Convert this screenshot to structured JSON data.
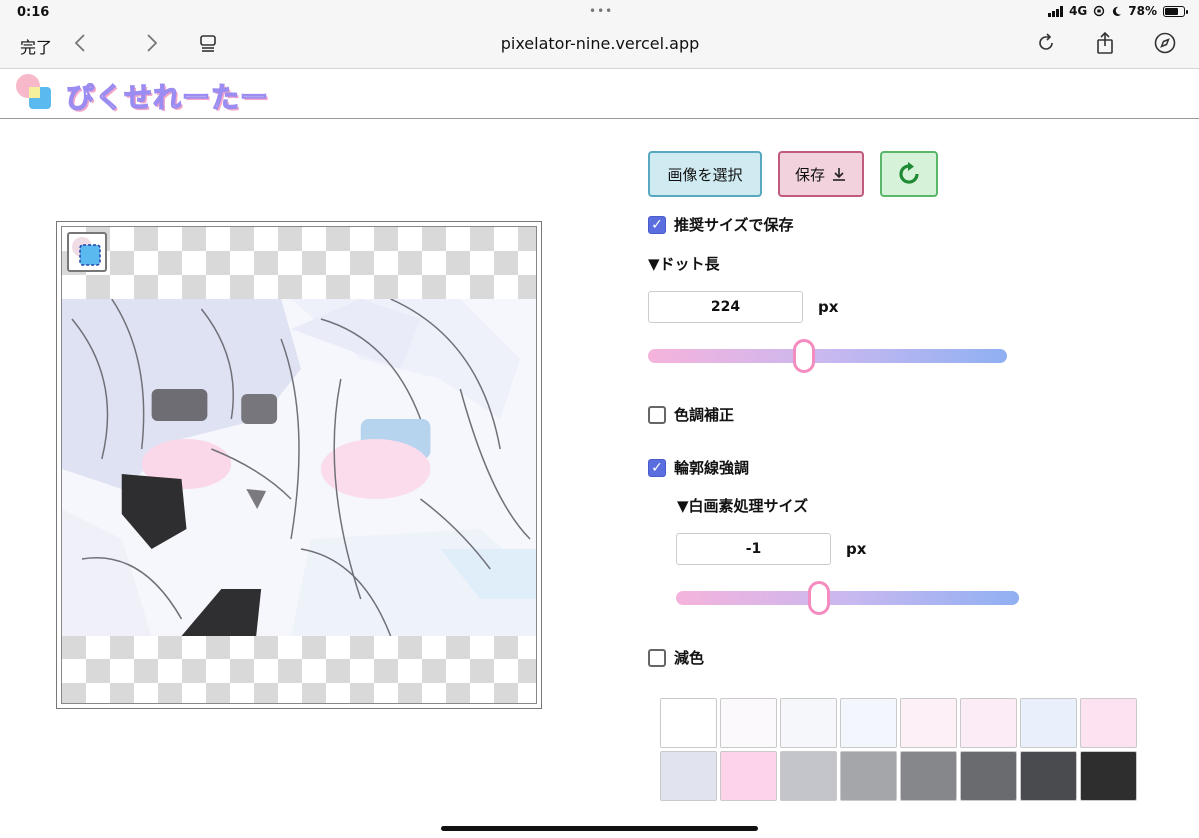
{
  "status_bar": {
    "time": "0:16",
    "network": "4G",
    "battery": "78%",
    "battery_level": 0.78
  },
  "browser": {
    "done_label": "完了",
    "url": "pixelator-nine.vercel.app",
    "icons": [
      "chevron-left-icon",
      "chevron-right-icon",
      "tabs-icon",
      "reload-icon",
      "share-icon",
      "compass-icon"
    ]
  },
  "app": {
    "title": "ぴくせれーたー"
  },
  "buttons": {
    "select_image": "画像を選択",
    "save": "保存",
    "save_icon": "download-icon",
    "reset_icon": "refresh-icon"
  },
  "options": {
    "recommended_size": {
      "label": "推奨サイズで保存",
      "checked": true
    },
    "dot_length": {
      "label": "▼ドット長",
      "value": "224",
      "unit": "px",
      "slider_fraction": 0.43
    },
    "color_correction": {
      "label": "色調補正",
      "checked": false
    },
    "edge_enhance": {
      "label": "輪郭線強調",
      "checked": true
    },
    "white_pixel_size": {
      "label": "▼白画素処理サイズ",
      "value": "-1",
      "unit": "px",
      "slider_fraction": 0.41
    },
    "reduce_colors": {
      "label": "減色",
      "checked": false
    }
  },
  "palette": [
    "#ffffff",
    "#fbf9fc",
    "#f6f7fb",
    "#f3f6fc",
    "#fdf1f7",
    "#fcecf6",
    "#eaf0fb",
    "#fde3f1",
    "#e1e4ee",
    "#fcd3e8",
    "#c4c5ca",
    "#a5a6aa",
    "#86878b",
    "#6a6b6f",
    "#4a4b4e",
    "#2e2e2f"
  ],
  "colors": {
    "accent": "#5b6ee0",
    "slider_start": "#f5b3dc",
    "slider_end": "#8fb0f2"
  }
}
